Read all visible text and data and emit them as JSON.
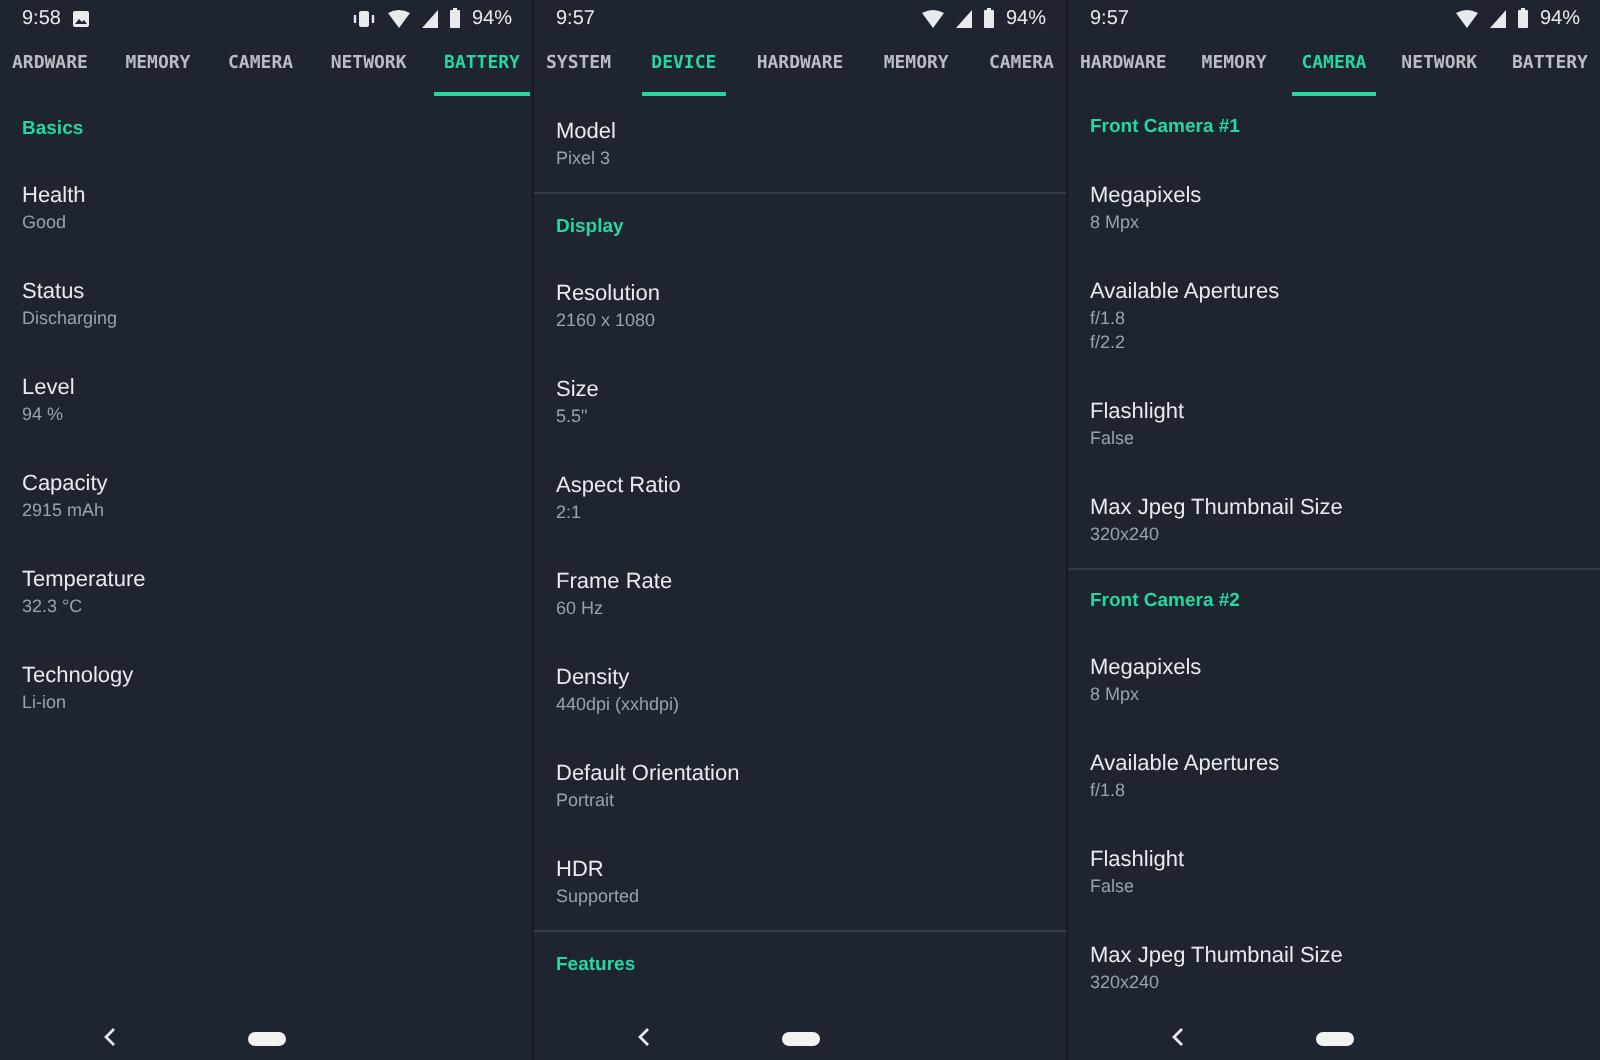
{
  "screens": [
    {
      "status": {
        "time": "9:58",
        "image_notification": true,
        "vibrate": true,
        "battery": "94%"
      },
      "tabs": [
        {
          "label": "ARDWARE",
          "selected": false
        },
        {
          "label": "MEMORY",
          "selected": false
        },
        {
          "label": "CAMERA",
          "selected": false
        },
        {
          "label": "NETWORK",
          "selected": false
        },
        {
          "label": "BATTERY",
          "selected": true
        }
      ],
      "content": [
        {
          "kind": "header",
          "text": "Basics"
        },
        {
          "kind": "item",
          "label": "Health",
          "values": [
            "Good"
          ]
        },
        {
          "kind": "item",
          "label": "Status",
          "values": [
            "Discharging"
          ]
        },
        {
          "kind": "item",
          "label": "Level",
          "values": [
            "94 %"
          ]
        },
        {
          "kind": "item",
          "label": "Capacity",
          "values": [
            "2915 mAh"
          ]
        },
        {
          "kind": "item",
          "label": "Temperature",
          "values": [
            "32.3 °C"
          ]
        },
        {
          "kind": "item",
          "label": "Technology",
          "values": [
            "Li-ion"
          ]
        }
      ]
    },
    {
      "status": {
        "time": "9:57",
        "image_notification": false,
        "vibrate": false,
        "battery": "94%"
      },
      "tabs": [
        {
          "label": "SYSTEM",
          "selected": false
        },
        {
          "label": "DEVICE",
          "selected": true
        },
        {
          "label": "HARDWARE",
          "selected": false
        },
        {
          "label": "MEMORY",
          "selected": false
        },
        {
          "label": "CAMERA",
          "selected": false
        }
      ],
      "content": [
        {
          "kind": "item",
          "label": "Model",
          "values": [
            "Pixel 3"
          ]
        },
        {
          "kind": "divider"
        },
        {
          "kind": "header",
          "text": "Display"
        },
        {
          "kind": "item",
          "label": "Resolution",
          "values": [
            "2160 x 1080"
          ]
        },
        {
          "kind": "item",
          "label": "Size",
          "values": [
            "5.5\""
          ]
        },
        {
          "kind": "item",
          "label": "Aspect Ratio",
          "values": [
            "2:1"
          ]
        },
        {
          "kind": "item",
          "label": "Frame Rate",
          "values": [
            "60 Hz"
          ]
        },
        {
          "kind": "item",
          "label": "Density",
          "values": [
            "440dpi (xxhdpi)"
          ]
        },
        {
          "kind": "item",
          "label": "Default Orientation",
          "values": [
            "Portrait"
          ]
        },
        {
          "kind": "item",
          "label": "HDR",
          "values": [
            "Supported"
          ]
        },
        {
          "kind": "divider"
        },
        {
          "kind": "header",
          "text": "Features"
        }
      ]
    },
    {
      "status": {
        "time": "9:57",
        "image_notification": false,
        "vibrate": false,
        "battery": "94%"
      },
      "tabs": [
        {
          "label": "HARDWARE",
          "selected": false
        },
        {
          "label": "MEMORY",
          "selected": false
        },
        {
          "label": "CAMERA",
          "selected": true
        },
        {
          "label": "NETWORK",
          "selected": false
        },
        {
          "label": "BATTERY",
          "selected": false
        }
      ],
      "content": [
        {
          "kind": "header",
          "text": "Front Camera #1"
        },
        {
          "kind": "item",
          "label": "Megapixels",
          "values": [
            "8 Mpx"
          ]
        },
        {
          "kind": "item",
          "label": "Available Apertures",
          "values": [
            "f/1.8",
            "f/2.2"
          ]
        },
        {
          "kind": "item",
          "label": "Flashlight",
          "values": [
            "False"
          ]
        },
        {
          "kind": "item",
          "label": "Max Jpeg Thumbnail Size",
          "values": [
            "320x240"
          ]
        },
        {
          "kind": "divider"
        },
        {
          "kind": "header",
          "text": "Front Camera #2"
        },
        {
          "kind": "item",
          "label": "Megapixels",
          "values": [
            "8 Mpx"
          ]
        },
        {
          "kind": "item",
          "label": "Available Apertures",
          "values": [
            "f/1.8"
          ]
        },
        {
          "kind": "item",
          "label": "Flashlight",
          "values": [
            "False"
          ]
        },
        {
          "kind": "item",
          "label": "Max Jpeg Thumbnail Size",
          "values": [
            "320x240"
          ]
        }
      ]
    }
  ]
}
